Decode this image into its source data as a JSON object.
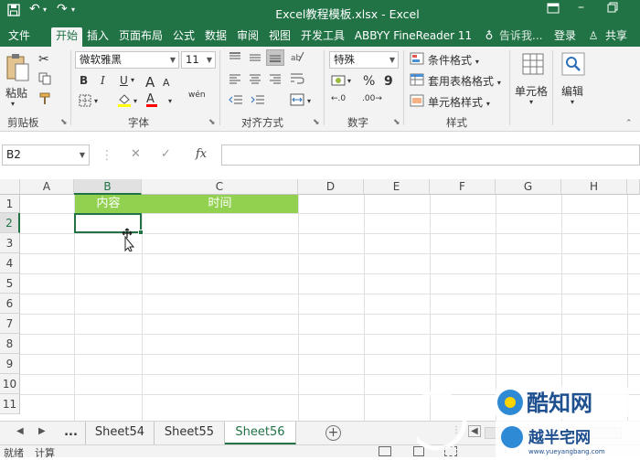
{
  "title_bar": {
    "title": "Excel教程模板.xlsx - Excel",
    "icons": [
      "save-icon",
      "undo-icon",
      "redo-icon",
      "ribbon-display-icon",
      "minimize-icon",
      "restore-icon",
      "close-icon"
    ]
  },
  "tabs": [
    {
      "label": "文件"
    },
    {
      "label": "开始"
    },
    {
      "label": "插入"
    },
    {
      "label": "页面布局"
    },
    {
      "label": "公式"
    },
    {
      "label": "数据"
    },
    {
      "label": "审阅"
    },
    {
      "label": "视图"
    },
    {
      "label": "开发工具"
    },
    {
      "label": "ABBYY FineReader 11"
    }
  ],
  "tell_me": "告诉我...",
  "login": "登录",
  "share": "共享",
  "ribbon": {
    "clipboard": {
      "paste": "粘贴",
      "group": "剪贴板"
    },
    "font": {
      "name": "微软雅黑",
      "size": "11",
      "group": "字体",
      "bold": "B",
      "italic": "I",
      "underline": "U",
      "grow": "A",
      "shrink": "A",
      "phonetic": "wén"
    },
    "alignment": {
      "group": "对齐方式"
    },
    "number": {
      "format": "特殊",
      "percent": "%",
      "comma": "9",
      "group": "数字",
      "inc_decimal": ".0",
      "dec_decimal": ".00"
    },
    "styles": {
      "conditional": "条件格式",
      "table": "套用表格格式",
      "cell": "单元格样式",
      "group": "样式"
    },
    "cells": {
      "label": "单元格"
    },
    "editing": {
      "label": "编辑"
    }
  },
  "formula_bar": {
    "name_box": "B2",
    "cancel": "✕",
    "enter": "✓",
    "fx": "fx",
    "value": ""
  },
  "columns": [
    "A",
    "B",
    "C",
    "D",
    "E",
    "F",
    "G",
    "H"
  ],
  "rows": [
    "1",
    "2",
    "3",
    "4",
    "5",
    "6",
    "7",
    "8",
    "9",
    "10",
    "11"
  ],
  "cells": {
    "B1": "内容",
    "C1": "时间"
  },
  "active_cell": "B2",
  "sheets": {
    "ellipsis": "...",
    "tabs": [
      {
        "label": "Sheet54"
      },
      {
        "label": "Sheet55"
      },
      {
        "label": "Sheet56"
      }
    ],
    "active": "Sheet56"
  },
  "status": {
    "ready": "就绪",
    "calc": "计算"
  },
  "watermark": {
    "brand": "酷知网",
    "brand2": "越半宅网",
    "url": "www.yueyangbang.com"
  },
  "colors": {
    "excel_green": "#217346",
    "header_fill": "#92d050",
    "ribbon_bg": "#f3f3f3"
  }
}
